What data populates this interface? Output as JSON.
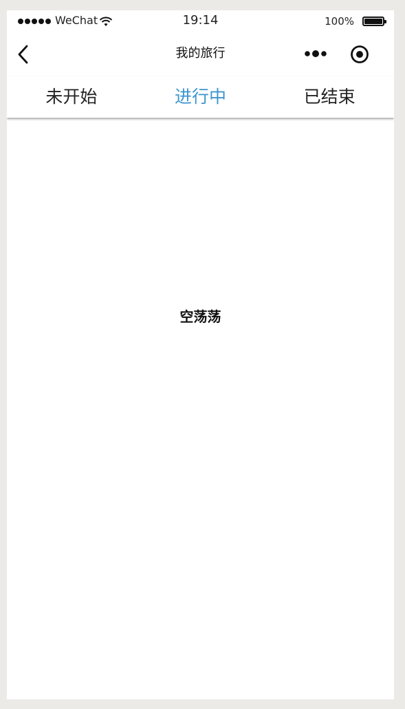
{
  "statusbar": {
    "carrier": "WeChat",
    "time": "19:14",
    "battery_percent": "100%",
    "icons": [
      "signal-dots-icon",
      "wifi-icon",
      "battery-icon"
    ]
  },
  "navbar": {
    "title": "我的旅行",
    "back_icon": "chevron-left-icon",
    "more_icon": "more-dots-icon",
    "close_icon": "target-circle-icon"
  },
  "tabs": [
    {
      "label": "未开始",
      "active": false
    },
    {
      "label": "进行中",
      "active": true
    },
    {
      "label": "已结束",
      "active": false
    }
  ],
  "colors": {
    "active_tab": "#3d95d0",
    "text": "#222222",
    "page_bg": "#ffffff",
    "outer_bg": "#ebeae7"
  },
  "content": {
    "empty_text": "空荡荡"
  }
}
